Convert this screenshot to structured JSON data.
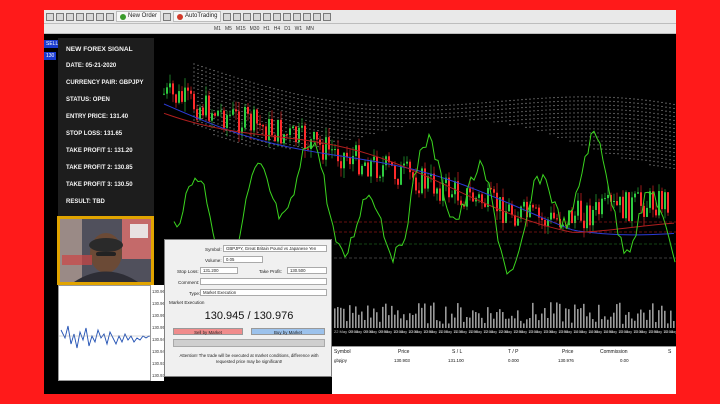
{
  "toolbar": {
    "new_order_label": "New Order",
    "autotrading_label": "AutoTrading",
    "timeframes": [
      "M1",
      "M5",
      "M15",
      "M30",
      "H1",
      "H4",
      "D1",
      "W1",
      "MN"
    ]
  },
  "side_tags": {
    "sell": "SELL",
    "price": "130"
  },
  "signal": {
    "title": "NEW FOREX SIGNAL",
    "date": "DATE: 05-21-2020",
    "pair": "CURRENCY PAIR: GBPJPY",
    "status": "STATUS: OPEN",
    "entry": "ENTRY PRICE: 131.40",
    "stop": "STOP LOSS: 131.65",
    "tp1": "TAKE PROFIT 1: 131.20",
    "tp2": "TAKE PROFIT 2: 130.85",
    "tp3": "TAKE PROFIT 3: 130.50",
    "result": "RESULT: TBD"
  },
  "mini_chart": {
    "ticks": [
      "130.965",
      "130.960",
      "130.955",
      "130.950",
      "130.945",
      "130.940",
      "130.935",
      "130.930"
    ]
  },
  "order": {
    "symbol_label": "Symbol:",
    "symbol_value": "GBPJPY, Great Britain Pound vs Japanese Yen",
    "volume_label": "Volume:",
    "volume_value": "0.05",
    "stoploss_label": "Stop Loss:",
    "stoploss_value": "131.200",
    "takeprofit_label": "Take Profit:",
    "takeprofit_value": "130.500",
    "comment_label": "Comment:",
    "comment_value": "",
    "type_label": "Type:",
    "type_value": "Market Execution",
    "section_label": "Market Execution",
    "prices": "130.945 / 130.976",
    "sell_label": "Sell by Market",
    "buy_label": "Buy by Market",
    "attention": "Attention! The trade will be executed at market conditions, difference with requested price may be significant!"
  },
  "terminal": {
    "headers": [
      "Symbol",
      "Price",
      "S / L",
      "T / P",
      "Price",
      "Commission",
      "S"
    ],
    "row": [
      "gbpjpy",
      "130.903",
      "131.100",
      "0.000",
      "130.976",
      "0.00"
    ]
  },
  "xaxis": {
    "labels": [
      "22 May 09:15",
      "22 May 09:35",
      "22 May 09:55",
      "22 May 10:15",
      "22 May 10:35",
      "22 May 10:55",
      "22 May 11:15",
      "22 May 11:35",
      "22 May 11:55",
      "22 May 12:15",
      "22 May 12:35",
      "22 May 12:55",
      "22 May 13:15",
      "22 May 13:35",
      "22 May 13:55",
      "22 May 14:15",
      "22 May 14:35",
      "22 May 14:55",
      "22 May 15:15",
      "22 May 15:35",
      "22 May 15:55",
      "22 May 16:15",
      "22 May 16:35"
    ]
  },
  "colors": {
    "frame": "#ff1a1a",
    "bull": "#2ecc40",
    "bear": "#ff2b2b",
    "cloud": "#9a9a9a",
    "oscillator": "#3bd61f",
    "ma_blue": "#2b3bd6",
    "sell_button": "#f08c8c",
    "buy_button": "#9cc2ec"
  }
}
